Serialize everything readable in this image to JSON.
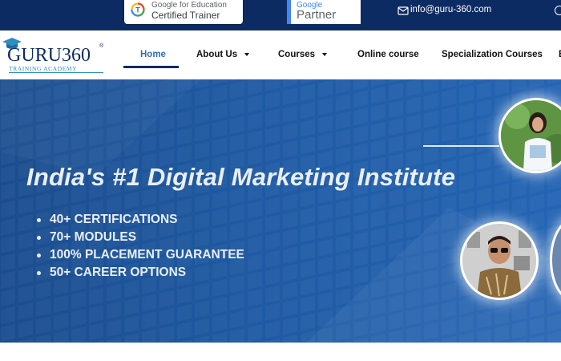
{
  "topbar": {
    "gfe_line1": "Google for Education",
    "gfe_line2": "Certified Trainer",
    "gp_google": "Google",
    "gp_partner": "Partner",
    "email": "info@guru-360.com"
  },
  "logo": {
    "name": "GURU360",
    "registered": "®",
    "subtitle": "TRAINING ACADEMY"
  },
  "nav": {
    "home": "Home",
    "about": "About Us",
    "courses": "Courses",
    "online": "Online course",
    "specialization": "Specialization Courses"
  },
  "hero": {
    "title": "India's #1 Digital Marketing Institute",
    "bullets": [
      "40+ CERTIFICATIONS",
      "70+ MODULES",
      "100% PLACEMENT GUARANTEE",
      "50+ CAREER OPTIONS"
    ]
  },
  "colors": {
    "navy": "#0d2b63",
    "hero_blue": "#1f5aa3",
    "nav_active": "#2f6fb5",
    "logo_accent": "#2b8ec1"
  },
  "icons": [
    "google-education-icon",
    "mail-icon",
    "graduation-cap-icon",
    "chevron-down-icon"
  ]
}
